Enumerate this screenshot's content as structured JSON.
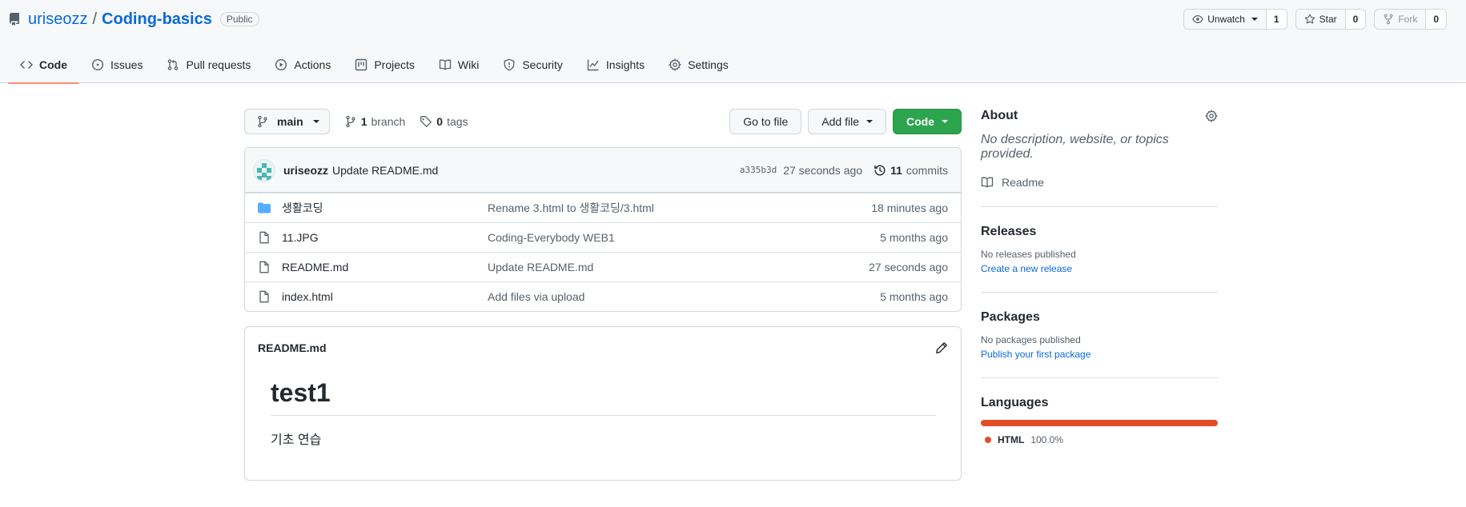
{
  "repo": {
    "owner": "uriseozz",
    "separator": "/",
    "name": "Coding-basics",
    "visibility": "Public"
  },
  "header_actions": {
    "watch_label": "Unwatch",
    "watch_count": "1",
    "star_label": "Star",
    "star_count": "0",
    "fork_label": "Fork",
    "fork_count": "0"
  },
  "tabs": [
    {
      "label": "Code",
      "icon": "code-icon",
      "active": true
    },
    {
      "label": "Issues",
      "icon": "issue-icon"
    },
    {
      "label": "Pull requests",
      "icon": "pull-request-icon"
    },
    {
      "label": "Actions",
      "icon": "play-icon"
    },
    {
      "label": "Projects",
      "icon": "project-icon"
    },
    {
      "label": "Wiki",
      "icon": "book-icon"
    },
    {
      "label": "Security",
      "icon": "shield-icon"
    },
    {
      "label": "Insights",
      "icon": "graph-icon"
    },
    {
      "label": "Settings",
      "icon": "gear-icon"
    }
  ],
  "toolbar": {
    "branch": "main",
    "branch_count": "1",
    "branch_label": "branch",
    "tag_count": "0",
    "tag_label": "tags",
    "go_to_file": "Go to file",
    "add_file": "Add file",
    "code": "Code"
  },
  "latest_commit": {
    "author": "uriseozz",
    "message": "Update README.md",
    "sha": "a335b3d",
    "time": "27 seconds ago",
    "commit_count": "11",
    "commit_label": "commits"
  },
  "files": [
    {
      "name": "생활코딩",
      "type": "folder",
      "message": "Rename 3.html to 생활코딩/3.html",
      "time": "18 minutes ago"
    },
    {
      "name": "11.JPG",
      "type": "file",
      "message": "Coding-Everybody WEB1",
      "time": "5 months ago"
    },
    {
      "name": "README.md",
      "type": "file",
      "message": "Update README.md",
      "time": "27 seconds ago"
    },
    {
      "name": "index.html",
      "type": "file",
      "message": "Add files via upload",
      "time": "5 months ago"
    }
  ],
  "readme": {
    "filename": "README.md",
    "heading": "test1",
    "body": "기초 연습"
  },
  "sidebar": {
    "about_title": "About",
    "about_desc": "No description, website, or topics provided.",
    "readme_label": "Readme",
    "releases_title": "Releases",
    "releases_text": "No releases published",
    "releases_link": "Create a new release",
    "packages_title": "Packages",
    "packages_text": "No packages published",
    "packages_link": "Publish your first package",
    "languages_title": "Languages",
    "languages": [
      {
        "name": "HTML",
        "percent": "100.0%",
        "share": 100,
        "color": "#e34c26"
      }
    ]
  },
  "colors": {
    "accent_link": "#0969da",
    "code_button": "#2da44e",
    "folder": "#54aeff",
    "active_tab_underline": "#fd8c73"
  }
}
